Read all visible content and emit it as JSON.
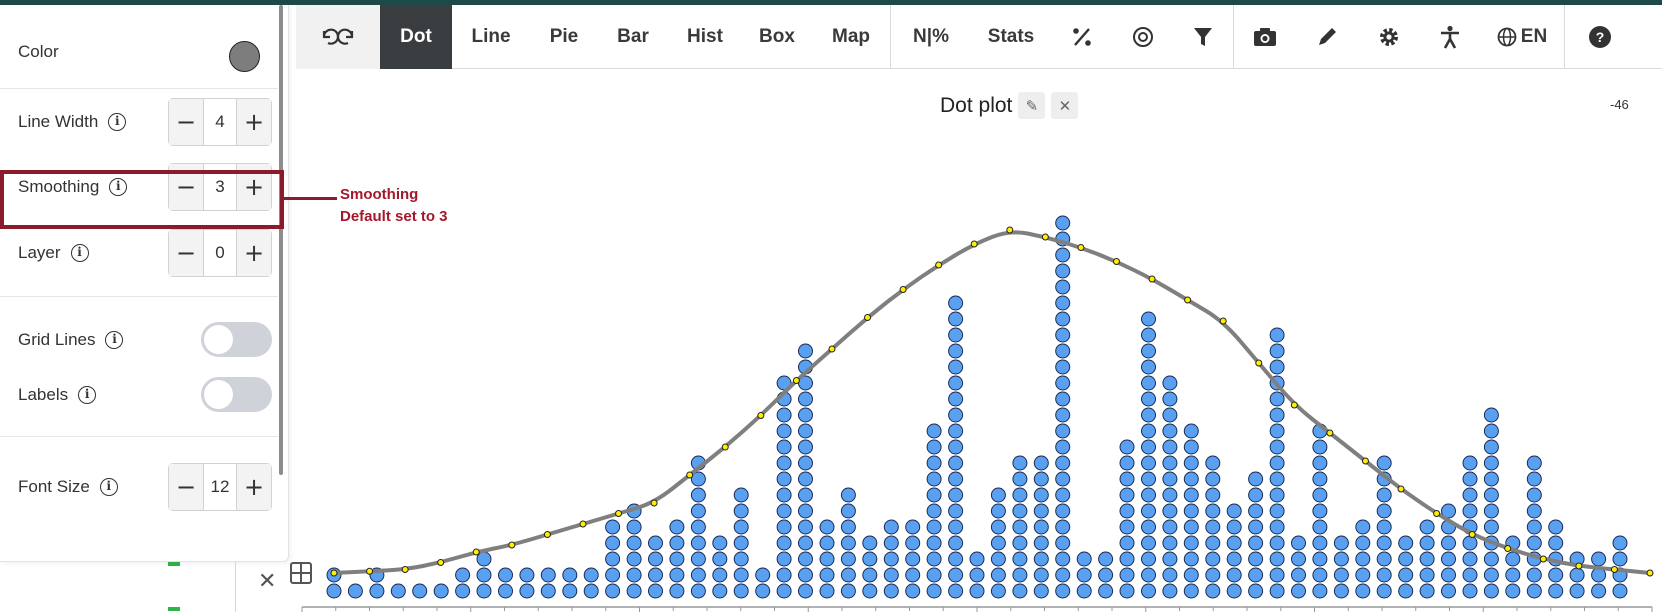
{
  "toolbar": {
    "buttons": [
      {
        "label": "Dot",
        "active": true
      },
      {
        "label": "Line"
      },
      {
        "label": "Pie"
      },
      {
        "label": "Bar"
      },
      {
        "label": "Hist"
      },
      {
        "label": "Box"
      },
      {
        "label": "Map"
      },
      {
        "label": "N|%"
      },
      {
        "label": "Stats"
      }
    ],
    "language": "EN",
    "help": "?"
  },
  "panel": {
    "color_label": "Color",
    "color_value": "#7d7d7d",
    "line_width": {
      "label": "Line Width",
      "value": "4"
    },
    "smoothing": {
      "label": "Smoothing",
      "value": "3"
    },
    "layer": {
      "label": "Layer",
      "value": "0"
    },
    "grid_lines": {
      "label": "Grid Lines",
      "on": false
    },
    "labels": {
      "label": "Labels",
      "on": false
    },
    "font_size": {
      "label": "Font Size",
      "value": "12"
    }
  },
  "callout": {
    "line1": "Smoothing",
    "line2": "Default set to 3",
    "color": "#a3192b"
  },
  "plot": {
    "title": "Dot plot",
    "corner_value": "-46"
  },
  "colors": {
    "dot_fill": "#5aa0f0",
    "dot_stroke": "#1a2a55",
    "curve": "#7f7f7f",
    "curve_point": "#ffee00"
  },
  "chart_data": {
    "type": "scatter",
    "title": "Dot plot",
    "dot_column_counts": [
      2,
      1,
      2,
      1,
      1,
      1,
      2,
      3,
      2,
      2,
      2,
      2,
      2,
      5,
      6,
      4,
      5,
      9,
      4,
      7,
      2,
      14,
      16,
      5,
      7,
      4,
      5,
      5,
      11,
      19,
      3,
      7,
      9,
      9,
      24,
      3,
      3,
      10,
      18,
      14,
      11,
      9,
      6,
      8,
      17,
      4,
      11,
      4,
      5,
      9,
      4,
      5,
      6,
      9,
      12,
      4,
      9,
      5,
      3,
      3,
      4
    ],
    "density_curve_points_y": [
      0.02,
      0.025,
      0.03,
      0.05,
      0.08,
      0.1,
      0.13,
      0.16,
      0.19,
      0.22,
      0.3,
      0.38,
      0.47,
      0.57,
      0.66,
      0.75,
      0.83,
      0.9,
      0.96,
      1.0,
      0.98,
      0.95,
      0.91,
      0.86,
      0.8,
      0.74,
      0.62,
      0.5,
      0.42,
      0.34,
      0.26,
      0.19,
      0.13,
      0.09,
      0.06,
      0.04,
      0.03,
      0.02
    ]
  }
}
